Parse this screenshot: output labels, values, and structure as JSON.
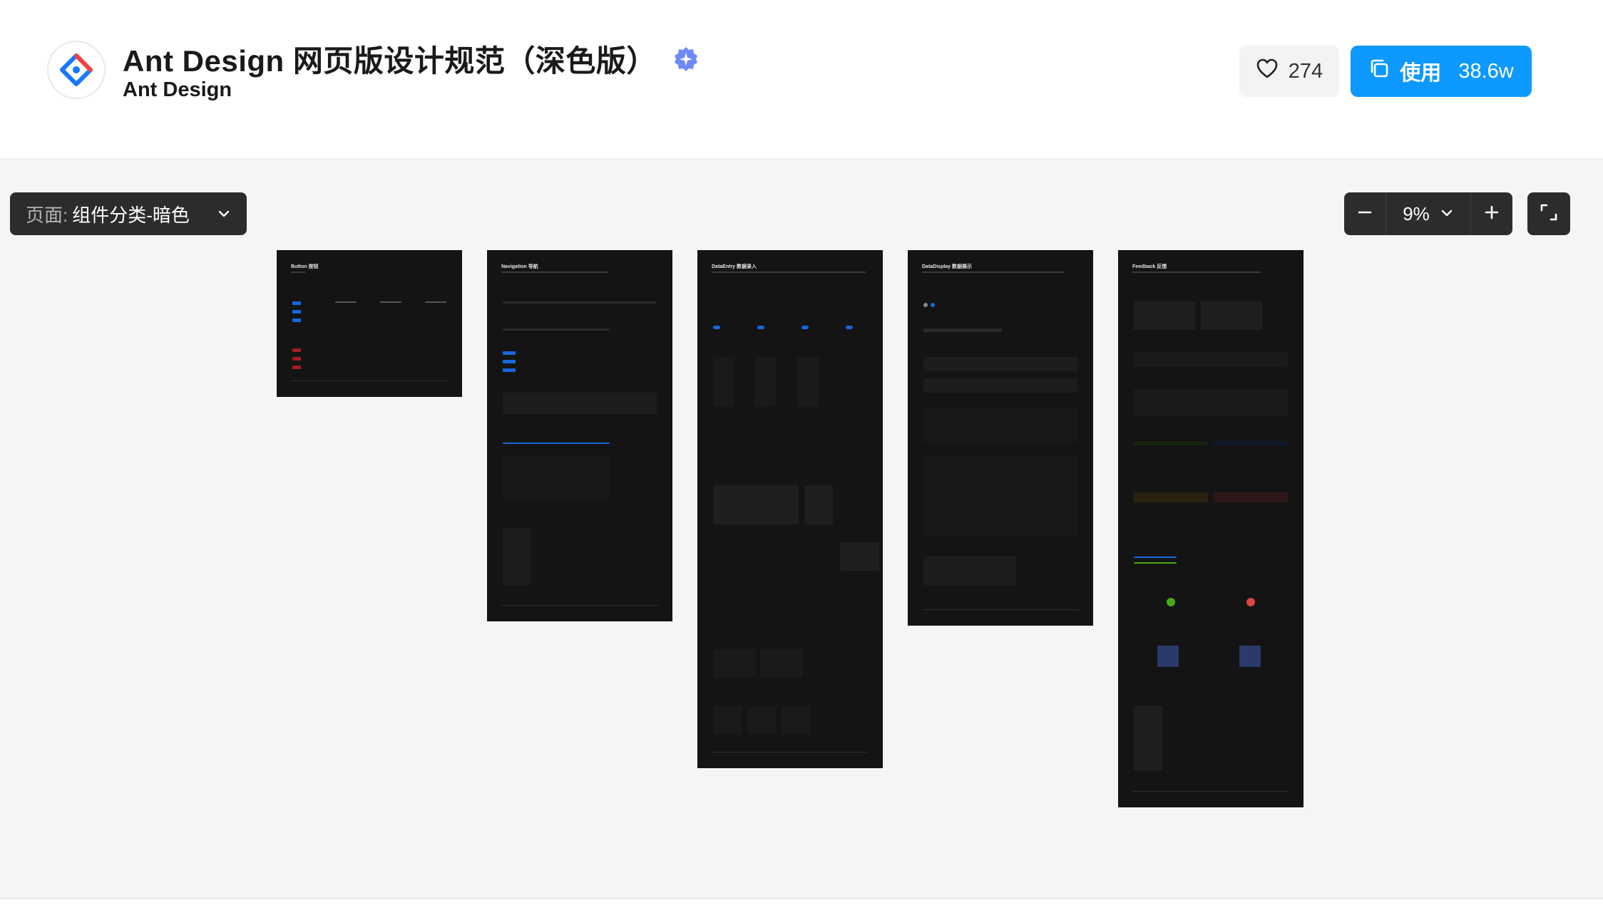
{
  "header": {
    "title": "Ant Design 网页版设计规范（深色版）",
    "author": "Ant Design",
    "likes": "274",
    "use_label": "使用",
    "use_count": "38.6w",
    "icons": {
      "logo": "ant-design-logo",
      "verified": "verified-badge-icon",
      "like": "heart-icon",
      "use": "copy-icon"
    }
  },
  "toolbar": {
    "page_label": "页面:",
    "page_value": "组件分类-暗色",
    "zoom_value": "9%"
  },
  "frames": [
    {
      "title": "Button 按钮"
    },
    {
      "title": "Navigation 导航"
    },
    {
      "title": "DataEntry 数据录入"
    },
    {
      "title": "DataDisplay 数据展示"
    },
    {
      "title": "Feedback 反馈"
    }
  ],
  "colors": {
    "primary": "#0d99ff",
    "frame_bg": "#141414",
    "toolbar_bg": "#2c2c2c",
    "canvas_bg": "#f5f5f5",
    "accent_blue": "#1668dc",
    "danger": "#dc4446",
    "success": "#49aa19"
  }
}
